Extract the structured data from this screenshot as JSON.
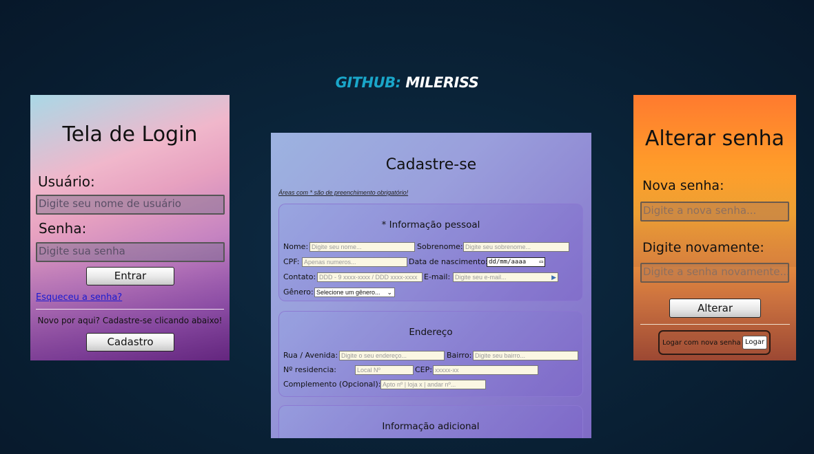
{
  "header": {
    "github_key": "GITHUB:",
    "github_user": "MILERISS"
  },
  "login": {
    "title": "Tela de Login",
    "user_label": "Usuário:",
    "user_placeholder": "Digite seu nome de usuário",
    "pass_label": "Senha:",
    "pass_placeholder": "Digite sua senha",
    "enter_label": "Entrar",
    "forgot_link": "Esqueceu a senha?",
    "new_text": "Novo por aqui? Cadastre-se clicando abaixo!",
    "register_label": "Cadastro"
  },
  "register": {
    "title": "Cadastre-se",
    "note": "Áreas com * são de preenchimento obrigatório!",
    "personal": {
      "title": "* Informação pessoal",
      "name_label": "Nome:",
      "name_placeholder": "Digite seu nome...",
      "surname_label": "Sobrenome:",
      "surname_placeholder": "Digite seu sobrenome...",
      "cpf_label": "CPF:",
      "cpf_placeholder": "Apenas numeros...",
      "birth_label": "Data de nascimento:",
      "birth_value": "dd/mm/aaaa",
      "contact_label": "Contato:",
      "contact_placeholder": "DDD - 9 xxxx-xxxx / DDD xxxx-xxxx",
      "email_label": "E-mail:",
      "email_placeholder": "Digite seu e-mail...",
      "gender_label": "Gênero:",
      "gender_selected": "Selecione um gênero..."
    },
    "address": {
      "title": "Endereço",
      "street_label": "Rua / Avenida:",
      "street_placeholder": "Digite o seu endereço...",
      "district_label": "Bairro:",
      "district_placeholder": "Digite seu bairro...",
      "number_label": "Nº residencia:",
      "number_placeholder": "Local Nº",
      "cep_label": "CEP:",
      "cep_placeholder": "xxxxx-xx",
      "complement_label": "Complemento (Opcional):",
      "complement_placeholder": "Apto nº | loja x | andar nº..."
    },
    "additional": {
      "title": "Informação adicional"
    }
  },
  "change": {
    "title": "Alterar senha",
    "new_label": "Nova senha:",
    "new_placeholder": "Digite a nova senha...",
    "again_label": "Digite novamente:",
    "again_placeholder": "Digite a senha novamente...",
    "alter_label": "Alterar",
    "login_text": "Logar com nova senha",
    "login_button": "Logar"
  }
}
